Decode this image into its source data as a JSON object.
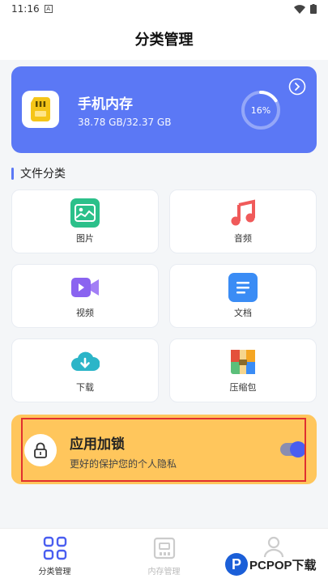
{
  "status": {
    "time": "11:16",
    "notif": "A"
  },
  "header": {
    "title": "分类管理"
  },
  "storage": {
    "name": "手机内存",
    "size": "38.78 GB/32.37 GB",
    "percent_text": "16%",
    "percent": 16
  },
  "section": {
    "title": "文件分类"
  },
  "categories": [
    {
      "label": "图片",
      "icon": "image-icon",
      "color": "#2bc08a"
    },
    {
      "label": "音频",
      "icon": "music-icon",
      "color": "#f05a5a"
    },
    {
      "label": "视频",
      "icon": "video-icon",
      "color": "#8a63f0"
    },
    {
      "label": "文档",
      "icon": "document-icon",
      "color": "#3a8cf5"
    },
    {
      "label": "下载",
      "icon": "download-icon",
      "color": "#2bb5c8"
    },
    {
      "label": "压缩包",
      "icon": "archive-icon",
      "color": "#e4503b"
    }
  ],
  "app_lock": {
    "title": "应用加锁",
    "description": "更好的保护您的个人隐私",
    "enabled": true
  },
  "tabs": [
    {
      "label": "分类管理",
      "icon": "grid-icon",
      "active": true
    },
    {
      "label": "内存管理",
      "icon": "storage-icon",
      "active": false
    },
    {
      "label": "",
      "icon": "user-icon",
      "active": false
    }
  ],
  "watermark": {
    "text": "PCPOP下载",
    "logo": "P"
  },
  "colors": {
    "primary": "#5b78f5",
    "lock_card": "#ffc65c",
    "highlight": "#e03030"
  }
}
